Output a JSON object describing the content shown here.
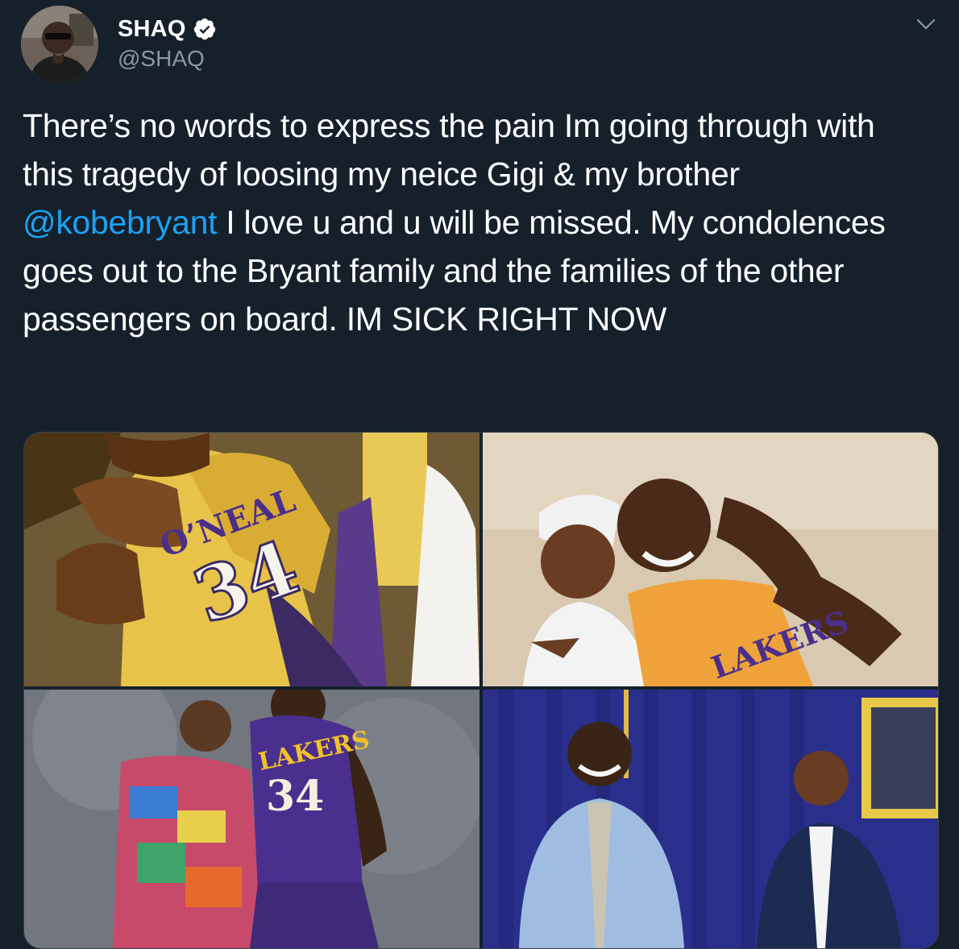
{
  "author": {
    "display_name": "SHAQ",
    "handle": "@SHAQ",
    "verified": true,
    "avatar_icon": "avatar-photo"
  },
  "tweet": {
    "text_before_mention": "There’s no words to express the pain Im going through with this tragedy of loosing my neice Gigi & my brother ",
    "mention": "@kobebryant",
    "text_after_mention": " I love u and u will be missed. My condolences goes out to the Bryant family and the families of the other passengers on board. IM SICK RIGHT NOW"
  },
  "menu": {
    "icon": "chevron-down-icon"
  },
  "media": {
    "photos": [
      {
        "jersey_name": "O’NEAL",
        "jersey_number": "34"
      },
      {
        "jersey_text": "LAKERS"
      },
      {
        "jersey_text": "LAKERS",
        "jersey_number": "34"
      },
      {}
    ]
  },
  "colors": {
    "background": "#15202b",
    "text": "#ffffff",
    "secondary_text": "#8899a6",
    "link": "#1da1f2",
    "border": "#38444d"
  }
}
